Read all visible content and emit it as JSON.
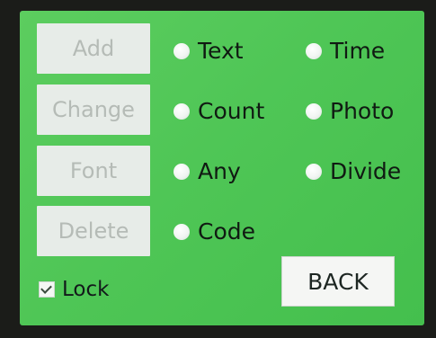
{
  "buttons": {
    "add": "Add",
    "change": "Change",
    "font": "Font",
    "delete": "Delete",
    "back": "BACK"
  },
  "options": {
    "text": "Text",
    "time": "Time",
    "count": "Count",
    "photo": "Photo",
    "any": "Any",
    "divide": "Divide",
    "code": "Code"
  },
  "lock": {
    "label": "Lock",
    "checked": true
  },
  "colors": {
    "screen": "#4fc656",
    "button_bg": "#e7ece8",
    "button_text": "#b5bbb6"
  }
}
